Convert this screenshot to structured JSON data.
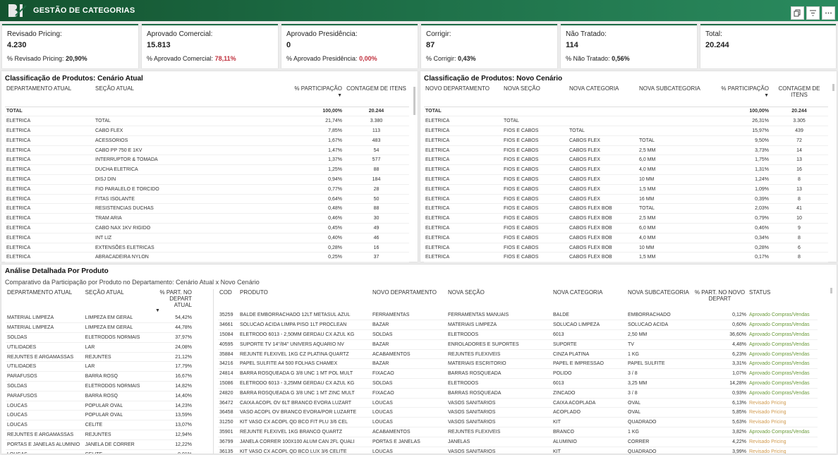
{
  "header": {
    "title": "GESTÃO DE CATEGORIAS",
    "logo": "BI"
  },
  "kpis": [
    {
      "label": "Revisado Pricing:",
      "value": "4.230",
      "sub_label": "% Revisado Pricing:",
      "sub_value": "20,90%",
      "sub_color": "#222"
    },
    {
      "label": "Aprovado Comercial:",
      "value": "15.813",
      "sub_label": "% Aprovado Comercial:",
      "sub_value": "78,11%",
      "sub_color": "#c0303d"
    },
    {
      "label": "Aprovado Presidência:",
      "value": "0",
      "sub_label": "% Aprovado Presidência:",
      "sub_value": "0,00%",
      "sub_color": "#c0303d"
    },
    {
      "label": "Corrigir:",
      "value": "87",
      "sub_label": "% Corrigir:",
      "sub_value": "0,43%",
      "sub_color": "#222"
    },
    {
      "label": "Não Tratado:",
      "value": "114",
      "sub_label": "% Não Tratado:",
      "sub_value": "0,56%",
      "sub_color": "#222"
    },
    {
      "label": "Total:",
      "value": "20.244",
      "sub_label": "",
      "sub_value": "",
      "sub_color": "#222"
    }
  ],
  "atual": {
    "title": "Classificação de Produtos: Cenário Atual",
    "headers": [
      "DEPARTAMENTO ATUAL",
      "SEÇÃO ATUAL",
      "% PARTICIPAÇÃO",
      "CONTAGEM DE ITENS"
    ],
    "total": [
      "TOTAL",
      "",
      "100,00%",
      "20.244"
    ],
    "rows": [
      [
        "ELETRICA",
        "TOTAL",
        "21,74%",
        "3.380"
      ],
      [
        "ELETRICA",
        "CABO FLEX",
        "7,85%",
        "113"
      ],
      [
        "ELETRICA",
        "ACESSORIOS",
        "1,67%",
        "483"
      ],
      [
        "ELETRICA",
        "CABO PP 750 E 1KV",
        "1,47%",
        "54"
      ],
      [
        "ELETRICA",
        "INTERRUPTOR & TOMADA",
        "1,37%",
        "577"
      ],
      [
        "ELETRICA",
        "DUCHA ELETRICA",
        "1,25%",
        "88"
      ],
      [
        "ELETRICA",
        "DISJ DIN",
        "0,94%",
        "184"
      ],
      [
        "ELETRICA",
        "FIO PARALELO E TORCIDO",
        "0,77%",
        "28"
      ],
      [
        "ELETRICA",
        "FITAS ISOLANTE",
        "0,64%",
        "50"
      ],
      [
        "ELETRICA",
        "RESISTENCIAS DUCHAS",
        "0,48%",
        "88"
      ],
      [
        "ELETRICA",
        "TRAM ARIA",
        "0,46%",
        "30"
      ],
      [
        "ELETRICA",
        "CABO NAX 1KV RIGIDO",
        "0,45%",
        "49"
      ],
      [
        "ELETRICA",
        "INT LIZ",
        "0,40%",
        "46"
      ],
      [
        "ELETRICA",
        "EXTENSÕES ELETRICAS",
        "0,28%",
        "16"
      ],
      [
        "ELETRICA",
        "ABRACADEIRA NYLON",
        "0,25%",
        "37"
      ]
    ]
  },
  "novo": {
    "title": "Classificação de Produtos: Novo Cenário",
    "headers": [
      "NOVO DEPARTAMENTO",
      "NOVA SEÇÃO",
      "NOVA CATEGORIA",
      "NOVA SUBCATEGORIA",
      "% PARTICIPAÇÃO",
      "CONTAGEM DE ITENS"
    ],
    "total": [
      "TOTAL",
      "",
      "",
      "",
      "100,00%",
      "20.244"
    ],
    "rows": [
      [
        "ELETRICA",
        "TOTAL",
        "",
        "",
        "26,31%",
        "3.305"
      ],
      [
        "ELETRICA",
        "FIOS E CABOS",
        "TOTAL",
        "",
        "15,97%",
        "439"
      ],
      [
        "ELETRICA",
        "FIOS E CABOS",
        "CABOS FLEX",
        "TOTAL",
        "9,50%",
        "72"
      ],
      [
        "ELETRICA",
        "FIOS E CABOS",
        "CABOS FLEX",
        "2,5 MM",
        "3,73%",
        "14"
      ],
      [
        "ELETRICA",
        "FIOS E CABOS",
        "CABOS FLEX",
        "6,0 MM",
        "1,75%",
        "13"
      ],
      [
        "ELETRICA",
        "FIOS E CABOS",
        "CABOS FLEX",
        "4,0 MM",
        "1,31%",
        "16"
      ],
      [
        "ELETRICA",
        "FIOS E CABOS",
        "CABOS FLEX",
        "10 MM",
        "1,24%",
        "8"
      ],
      [
        "ELETRICA",
        "FIOS E CABOS",
        "CABOS FLEX",
        "1,5 MM",
        "1,09%",
        "13"
      ],
      [
        "ELETRICA",
        "FIOS E CABOS",
        "CABOS FLEX",
        "16 MM",
        "0,39%",
        "8"
      ],
      [
        "ELETRICA",
        "FIOS E CABOS",
        "CABOS FLEX BOB",
        "TOTAL",
        "2,03%",
        "41"
      ],
      [
        "ELETRICA",
        "FIOS E CABOS",
        "CABOS FLEX BOB",
        "2,5 MM",
        "0,79%",
        "10"
      ],
      [
        "ELETRICA",
        "FIOS E CABOS",
        "CABOS FLEX BOB",
        "6,0 MM",
        "0,46%",
        "9"
      ],
      [
        "ELETRICA",
        "FIOS E CABOS",
        "CABOS FLEX BOB",
        "4,0 MM",
        "0,34%",
        "8"
      ],
      [
        "ELETRICA",
        "FIOS E CABOS",
        "CABOS FLEX BOB",
        "10 MM",
        "0,28%",
        "6"
      ],
      [
        "ELETRICA",
        "FIOS E CABOS",
        "CABOS FLEX BOB",
        "1,5 MM",
        "0,17%",
        "8"
      ]
    ]
  },
  "detalhe": {
    "title": "Análise Detalhada Por Produto",
    "subtitle": "Comparativo da Participação por Produto no Departamento: Cenário Atual x Novo Cenário",
    "left_headers": [
      "DEPARTAMENTO ATUAL",
      "SEÇÃO ATUAL",
      "% PART. NO DEPART ATUAL"
    ],
    "right_headers": [
      "COD",
      "PRODUTO",
      "NOVO DEPARTAMENTO",
      "NOVA SEÇÃO",
      "NOVA CATEGORIA",
      "NOVA SUBCATEGORIA",
      "% PART. NO NOVO DEPART",
      "STATUS"
    ],
    "left_rows": [
      [
        "MATERIAL LIMPEZA",
        "LIMPEZA EM GERAL",
        "54,42%"
      ],
      [
        "MATERIAL LIMPEZA",
        "LIMPEZA EM GERAL",
        "44,78%"
      ],
      [
        "SOLDAS",
        "ELETRODOS NORMAIS",
        "37,97%"
      ],
      [
        "UTILIDADES",
        "LAR",
        "24,08%"
      ],
      [
        "REJUNTES E ARGAMASSAS",
        "REJUNTES",
        "21,12%"
      ],
      [
        "UTILIDADES",
        "LAR",
        "17,79%"
      ],
      [
        "PARAFUSOS",
        "BARRA ROSQ",
        "16,67%"
      ],
      [
        "SOLDAS",
        "ELETRODOS NORMAIS",
        "14,82%"
      ],
      [
        "PARAFUSOS",
        "BARRA ROSQ",
        "14,40%"
      ],
      [
        "LOUCAS",
        "POPULAR OVAL",
        "14,23%"
      ],
      [
        "LOUCAS",
        "POPULAR OVAL",
        "13,59%"
      ],
      [
        "LOUCAS",
        "CELITE",
        "13,07%"
      ],
      [
        "REJUNTES E ARGAMASSAS",
        "REJUNTES",
        "12,94%"
      ],
      [
        "PORTAS E JANELAS ALUMINIO",
        "JANELA DE CORRER",
        "12,22%"
      ],
      [
        "LOUCAS",
        "CELITE",
        "9,01%"
      ]
    ],
    "right_rows": [
      [
        "35259",
        "BALDE EMBORRACHADO 12LT METASUL AZUL",
        "FERRAMENTAS",
        "FERRAMENTAS MANUAIS",
        "BALDE",
        "EMBORRACHADO",
        "0,12%",
        "Aprovado Compras/Vendas"
      ],
      [
        "34661",
        "SOLUCAO ACIDA LIMPA PISO 1LT PROCLEAN",
        "BAZAR",
        "MATERIAIS LIMPEZA",
        "SOLUCAO LIMPEZA",
        "SOLUCAO ACIDA",
        "0,60%",
        "Aprovado Compras/Vendas"
      ],
      [
        "15084",
        "ELETRODO 6013 - 2,50MM GERDAU CX AZUL KG",
        "SOLDAS",
        "ELETRODOS",
        "6013",
        "2,50 MM",
        "36,60%",
        "Aprovado Compras/Vendas"
      ],
      [
        "40595",
        "SUPORTE TV 14''/84'' UNIVERS AQUARIO NV",
        "BAZAR",
        "ENROLADORES E SUPORTES",
        "SUPORTE",
        "TV",
        "4,48%",
        "Aprovado Compras/Vendas"
      ],
      [
        "35884",
        "REJUNTE FLEXIVEL 1KG CZ PLATINA QUARTZ",
        "ACABAMENTOS",
        "REJUNTES FLEXIVEIS",
        "CINZA PLATINA",
        "1 KG",
        "6,23%",
        "Aprovado Compras/Vendas"
      ],
      [
        "34216",
        "PAPEL SULFITE A4 500 FOLHAS CHAMEX",
        "BAZAR",
        "MATERIAIS ESCRITORIO",
        "PAPEL E IMPRESSAO",
        "PAPEL SULFITE",
        "3,31%",
        "Aprovado Compras/Vendas"
      ],
      [
        "24814",
        "BARRA ROSQUEADA G 3/8 UNC 1 MT POL MULT",
        "FIXACAO",
        "BARRAS ROSQUEADA",
        "POLIDO",
        "3 / 8",
        "1,07%",
        "Aprovado Compras/Vendas"
      ],
      [
        "15086",
        "ELETRODO 6013 - 3,25MM GERDAU CX AZUL KG",
        "SOLDAS",
        "ELETRODOS",
        "6013",
        "3,25 MM",
        "14,28%",
        "Aprovado Compras/Vendas"
      ],
      [
        "24820",
        "BARRA ROSQUEADA G 3/8 UNC 1 MT ZINC MULT",
        "FIXACAO",
        "BARRAS ROSQUEADA",
        "ZINCADO",
        "3 / 8",
        "0,93%",
        "Aprovado Compras/Vendas"
      ],
      [
        "36472",
        "CAIXA ACOPL OV 6LT BRANCO EVORA LUZART",
        "LOUCAS",
        "VASOS SANITARIOS",
        "CAIXA ACOPLADA",
        "OVAL",
        "6,13%",
        "Revisado Pricing"
      ],
      [
        "36458",
        "VASO ACOPL OV BRANCO EVORA/POR LUZARTE",
        "LOUCAS",
        "VASOS SANITARIOS",
        "ACOPLADO",
        "OVAL",
        "5,85%",
        "Revisado Pricing"
      ],
      [
        "31250",
        "KIT VASO CX ACOPL QD BCO FIT PLU 3/6 CEL",
        "LOUCAS",
        "VASOS SANITARIOS",
        "KIT",
        "QUADRADO",
        "5,63%",
        "Revisado Pricing"
      ],
      [
        "35901",
        "REJUNTE FLEXIVEL 1KG BRANCO QUARTZ",
        "ACABAMENTOS",
        "REJUNTES FLEXIVEIS",
        "BRANCO",
        "1 KG",
        "3,82%",
        "Aprovado Compras/Vendas"
      ],
      [
        "36799",
        "JANELA CORRER 100X100 ALUM CAN 2FL QUALI",
        "PORTAS E JANELAS",
        "JANELAS",
        "ALUMINIO",
        "CORRER",
        "4,22%",
        "Revisado Pricing"
      ],
      [
        "36135",
        "KIT VASO CX ACOPL QD BCO LUX 3/6 CELITE",
        "LOUCAS",
        "VASOS SANITARIOS",
        "KIT",
        "QUADRADO",
        "3,99%",
        "Revisado Pricing"
      ]
    ]
  },
  "colors": {
    "accent": "#1d6b45",
    "approved": "#6a9a3a",
    "pricing": "#d19a4e",
    "negative": "#c0303d"
  },
  "icons": {
    "copy": "copy-icon",
    "filter": "filter-icon",
    "more": "more-icon"
  }
}
